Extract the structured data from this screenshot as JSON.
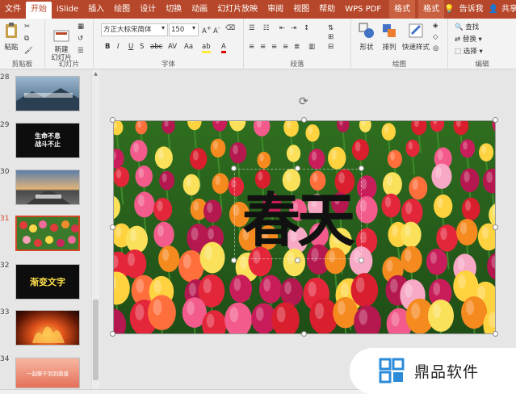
{
  "tabs": [
    "文件",
    "开始",
    "iSlide",
    "插入",
    "绘图",
    "设计",
    "切换",
    "动画",
    "幻灯片放映",
    "审阅",
    "视图",
    "帮助",
    "WPS PDF",
    "格式",
    "格式"
  ],
  "tab_right": {
    "tell": "告诉我",
    "share": "共享"
  },
  "ribbon": {
    "clipboard": {
      "paste": "粘贴",
      "label": "剪贴板"
    },
    "slides": {
      "new_slide": "新建\n幻灯片",
      "label": "幻灯片"
    },
    "font": {
      "name": "方正大标宋简体",
      "size": "150",
      "label": "字体"
    },
    "paragraph": {
      "label": "段落"
    },
    "drawing": {
      "shape": "形状",
      "arrange": "排列",
      "quick_style": "快速样式",
      "label": "绘图"
    },
    "editing": {
      "find": "查找",
      "replace": "替换",
      "select": "选择",
      "label": "编辑"
    }
  },
  "thumbnails": [
    {
      "num": "28",
      "text": ""
    },
    {
      "num": "29",
      "text": "生命不息\n战斗不止"
    },
    {
      "num": "30",
      "text": ""
    },
    {
      "num": "31",
      "text": ""
    },
    {
      "num": "32",
      "text": "渐变文字"
    },
    {
      "num": "33",
      "text": ""
    },
    {
      "num": "34",
      "text": "一起聊干到到鼎盛"
    }
  ],
  "slide": {
    "title": "春天"
  },
  "watermark": {
    "text": "鼎品软件"
  },
  "colors": {
    "accent": "#b7472a",
    "selected": "#d24726"
  }
}
